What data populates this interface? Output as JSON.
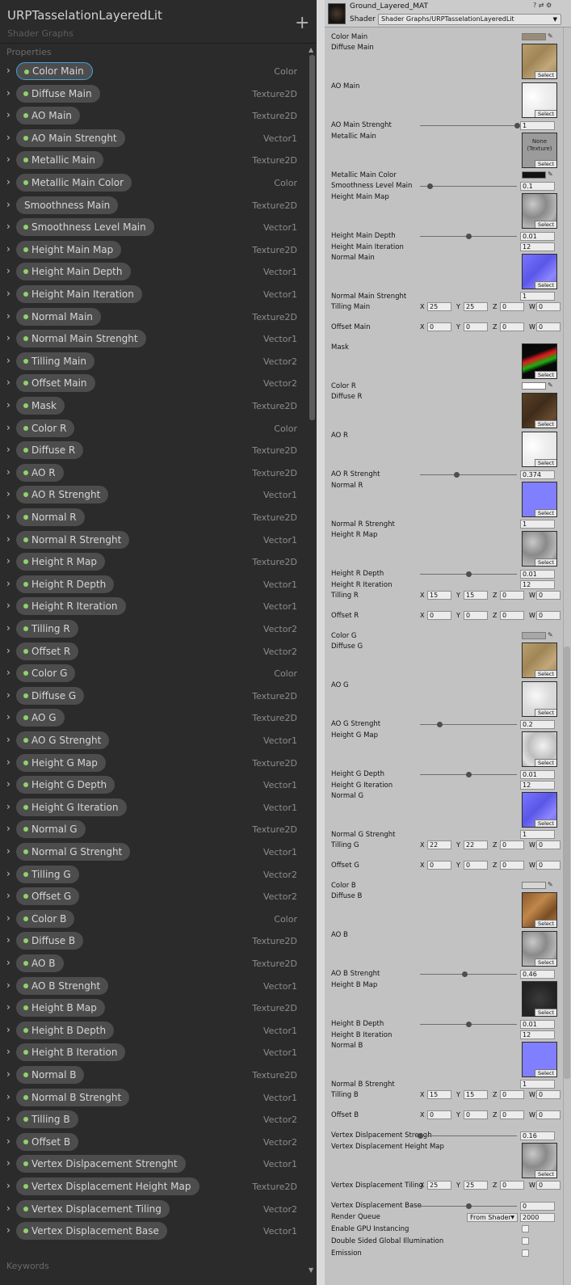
{
  "blackboard": {
    "title": "URPTasselationLayeredLit",
    "subtitle": "Shader Graphs",
    "add_icon": "+",
    "properties_label": "Properties",
    "keywords_label": "Keywords",
    "properties": [
      {
        "name": "Color Main",
        "type": "Color",
        "selected": true,
        "dot": true
      },
      {
        "name": "Diffuse Main",
        "type": "Texture2D",
        "dot": true
      },
      {
        "name": "AO Main",
        "type": "Texture2D",
        "dot": true
      },
      {
        "name": "AO Main Strenght",
        "type": "Vector1",
        "dot": true
      },
      {
        "name": "Metallic Main",
        "type": "Texture2D",
        "dot": true
      },
      {
        "name": "Metallic Main Color",
        "type": "Color",
        "dot": true
      },
      {
        "name": "Smoothness Main",
        "type": "Texture2D",
        "dot": false
      },
      {
        "name": "Smoothness Level Main",
        "type": "Vector1",
        "dot": true
      },
      {
        "name": "Height Main Map",
        "type": "Texture2D",
        "dot": true
      },
      {
        "name": "Height Main Depth",
        "type": "Vector1",
        "dot": true
      },
      {
        "name": "Height Main Iteration",
        "type": "Vector1",
        "dot": true
      },
      {
        "name": "Normal Main",
        "type": "Texture2D",
        "dot": true
      },
      {
        "name": "Normal Main Strenght",
        "type": "Vector1",
        "dot": true
      },
      {
        "name": "Tilling Main",
        "type": "Vector2",
        "dot": true
      },
      {
        "name": "Offset Main",
        "type": "Vector2",
        "dot": true
      },
      {
        "name": "Mask",
        "type": "Texture2D",
        "dot": true
      },
      {
        "name": "Color R",
        "type": "Color",
        "dot": true
      },
      {
        "name": "Diffuse R",
        "type": "Texture2D",
        "dot": true
      },
      {
        "name": "AO R",
        "type": "Texture2D",
        "dot": true
      },
      {
        "name": "AO R Strenght",
        "type": "Vector1",
        "dot": true
      },
      {
        "name": "Normal R",
        "type": "Texture2D",
        "dot": true
      },
      {
        "name": "Normal R Strenght",
        "type": "Vector1",
        "dot": true
      },
      {
        "name": "Height R Map",
        "type": "Texture2D",
        "dot": true
      },
      {
        "name": "Height R Depth",
        "type": "Vector1",
        "dot": true
      },
      {
        "name": "Height R Iteration",
        "type": "Vector1",
        "dot": true
      },
      {
        "name": "Tilling R",
        "type": "Vector2",
        "dot": true
      },
      {
        "name": "Offset R",
        "type": "Vector2",
        "dot": true
      },
      {
        "name": "Color G",
        "type": "Color",
        "dot": true
      },
      {
        "name": "Diffuse G",
        "type": "Texture2D",
        "dot": true
      },
      {
        "name": "AO G",
        "type": "Texture2D",
        "dot": true
      },
      {
        "name": "AO G Strenght",
        "type": "Vector1",
        "dot": true
      },
      {
        "name": "Height G Map",
        "type": "Texture2D",
        "dot": true
      },
      {
        "name": "Height G Depth",
        "type": "Vector1",
        "dot": true
      },
      {
        "name": "Height G Iteration",
        "type": "Vector1",
        "dot": true
      },
      {
        "name": "Normal G",
        "type": "Texture2D",
        "dot": true
      },
      {
        "name": "Normal G Strenght",
        "type": "Vector1",
        "dot": true
      },
      {
        "name": "Tilling G",
        "type": "Vector2",
        "dot": true
      },
      {
        "name": "Offset G",
        "type": "Vector2",
        "dot": true
      },
      {
        "name": "Color B",
        "type": "Color",
        "dot": true
      },
      {
        "name": "Diffuse B",
        "type": "Texture2D",
        "dot": true
      },
      {
        "name": "AO B",
        "type": "Texture2D",
        "dot": true
      },
      {
        "name": "AO B Strenght",
        "type": "Vector1",
        "dot": true
      },
      {
        "name": "Height B Map",
        "type": "Texture2D",
        "dot": true
      },
      {
        "name": "Height B Depth",
        "type": "Vector1",
        "dot": true
      },
      {
        "name": "Height B Iteration",
        "type": "Vector1",
        "dot": true
      },
      {
        "name": "Normal B",
        "type": "Texture2D",
        "dot": true
      },
      {
        "name": "Normal B Strenght",
        "type": "Vector1",
        "dot": true
      },
      {
        "name": "Tilling B",
        "type": "Vector2",
        "dot": true
      },
      {
        "name": "Offset B",
        "type": "Vector2",
        "dot": true
      },
      {
        "name": "Vertex Dislpacement Strenght",
        "type": "Vector1",
        "dot": true
      },
      {
        "name": "Vertex Displacement Height Map",
        "type": "Texture2D",
        "dot": true
      },
      {
        "name": "Vertex Displacement Tiling",
        "type": "Vector2",
        "dot": true
      },
      {
        "name": "Vertex Displacement Base",
        "type": "Vector1",
        "dot": true
      }
    ]
  },
  "inspector": {
    "material_name": "Ground_Layered_MAT",
    "shader_label": "Shader",
    "shader_value": "Shader Graphs/URPTasselationLayeredLit",
    "header_icons": "? ⇄ ⚙",
    "select_label": "Select",
    "none_texture_label": "None\n(Texture)",
    "entries": [
      {
        "kind": "color",
        "label": "Color Main",
        "color": "#998d7a"
      },
      {
        "kind": "texture",
        "label": "Diffuse Main",
        "tex": "sand"
      },
      {
        "kind": "texture",
        "label": "AO Main",
        "tex": "ao_white"
      },
      {
        "kind": "slider",
        "label": "AO Main Strenght",
        "value": "1",
        "fraction": 1.0
      },
      {
        "kind": "texture",
        "label": "Metallic Main",
        "tex": "none"
      },
      {
        "kind": "color",
        "label": "Metallic Main Color",
        "color": "#111111"
      },
      {
        "kind": "slider",
        "label": "Smoothness Level Main",
        "value": "0.1",
        "fraction": 0.1
      },
      {
        "kind": "texture",
        "label": "Height Main Map",
        "tex": "noise_gray"
      },
      {
        "kind": "slider",
        "label": "Height Main Depth",
        "value": "0.01",
        "fraction": 0.5
      },
      {
        "kind": "field",
        "label": "Height Main Iteration",
        "value": "12"
      },
      {
        "kind": "texture",
        "label": "Normal Main",
        "tex": "normal"
      },
      {
        "kind": "field",
        "label": "Normal Main Strenght",
        "value": "1"
      },
      {
        "kind": "vec4",
        "label": "Tilling Main",
        "x": "25",
        "y": "25",
        "z": "0",
        "w": "0"
      },
      {
        "kind": "vec4",
        "label": "Offset Main",
        "x": "0",
        "y": "0",
        "z": "0",
        "w": "0"
      },
      {
        "kind": "texture",
        "label": "Mask",
        "tex": "mask"
      },
      {
        "kind": "color",
        "label": "Color R",
        "color": "#ffffff"
      },
      {
        "kind": "texture",
        "label": "Diffuse R",
        "tex": "dirt_dark"
      },
      {
        "kind": "texture",
        "label": "AO R",
        "tex": "ao_white"
      },
      {
        "kind": "slider",
        "label": "AO R Strenght",
        "value": "0.374",
        "fraction": 0.374
      },
      {
        "kind": "texture",
        "label": "Normal R",
        "tex": "normal_flat"
      },
      {
        "kind": "field",
        "label": "Normal R Strenght",
        "value": "1"
      },
      {
        "kind": "texture",
        "label": "Height R Map",
        "tex": "noise_gray"
      },
      {
        "kind": "slider",
        "label": "Height R Depth",
        "value": "0.01",
        "fraction": 0.5
      },
      {
        "kind": "field",
        "label": "Height R Iteration",
        "value": "12"
      },
      {
        "kind": "vec4",
        "label": "Tilling R",
        "x": "15",
        "y": "15",
        "z": "0",
        "w": "0"
      },
      {
        "kind": "vec4",
        "label": "Offset R",
        "x": "0",
        "y": "0",
        "z": "0",
        "w": "0"
      },
      {
        "kind": "color",
        "label": "Color G",
        "color": "#a7a7a7"
      },
      {
        "kind": "texture",
        "label": "Diffuse G",
        "tex": "sand"
      },
      {
        "kind": "texture",
        "label": "AO G",
        "tex": "ao_light"
      },
      {
        "kind": "slider",
        "label": "AO G Strenght",
        "value": "0.2",
        "fraction": 0.2
      },
      {
        "kind": "texture",
        "label": "Height G Map",
        "tex": "noise_light"
      },
      {
        "kind": "slider",
        "label": "Height G Depth",
        "value": "0.01",
        "fraction": 0.5
      },
      {
        "kind": "field",
        "label": "Height G Iteration",
        "value": "12"
      },
      {
        "kind": "texture",
        "label": "Normal G",
        "tex": "normal"
      },
      {
        "kind": "field",
        "label": "Normal G Strenght",
        "value": "1"
      },
      {
        "kind": "vec4",
        "label": "Tilling G",
        "x": "22",
        "y": "22",
        "z": "0",
        "w": "0"
      },
      {
        "kind": "vec4",
        "label": "Offset G",
        "x": "0",
        "y": "0",
        "z": "0",
        "w": "0"
      },
      {
        "kind": "color",
        "label": "Color B",
        "color": "#d6d6d6"
      },
      {
        "kind": "texture",
        "label": "Diffuse B",
        "tex": "dirt_orange"
      },
      {
        "kind": "texture",
        "label": "AO B",
        "tex": "noise_gray"
      },
      {
        "kind": "slider",
        "label": "AO B Strenght",
        "value": "0.46",
        "fraction": 0.46
      },
      {
        "kind": "texture",
        "label": "Height B Map",
        "tex": "dark"
      },
      {
        "kind": "slider",
        "label": "Height B Depth",
        "value": "0.01",
        "fraction": 0.5
      },
      {
        "kind": "field",
        "label": "Height B Iteration",
        "value": "12"
      },
      {
        "kind": "texture",
        "label": "Normal B",
        "tex": "normal_flat"
      },
      {
        "kind": "field",
        "label": "Normal B Strenght",
        "value": "1"
      },
      {
        "kind": "vec4",
        "label": "Tilling B",
        "x": "15",
        "y": "15",
        "z": "0",
        "w": "0"
      },
      {
        "kind": "vec4",
        "label": "Offset B",
        "x": "0",
        "y": "0",
        "z": "0",
        "w": "0"
      },
      {
        "kind": "slider",
        "label": "Vertex Dislpacement Strengh",
        "value": "0.16",
        "fraction": 0.0
      },
      {
        "kind": "texture",
        "label": "Vertex Displacement Height Map",
        "tex": "noise_gray"
      },
      {
        "kind": "vec4",
        "label": "Vertex Displacement Tiling",
        "x": "25",
        "y": "25",
        "z": "0",
        "w": "0"
      },
      {
        "kind": "slider",
        "label": "Vertex Displacement Base",
        "value": "0",
        "fraction": 0.5
      },
      {
        "kind": "dropdown",
        "label": "Render Queue",
        "option": "From Shader",
        "value": "2000"
      },
      {
        "kind": "checkbox",
        "label": "Enable GPU Instancing",
        "checked": false
      },
      {
        "kind": "checkbox",
        "label": "Double Sided Global Illumination",
        "checked": false
      },
      {
        "kind": "checkbox",
        "label": "Emission",
        "checked": false
      }
    ]
  },
  "colors": {
    "blackboard_bg": "#2b2b2b",
    "pill_bg": "#4d4d4d",
    "dot_green": "#8fd36a",
    "selection_blue": "#41a2e0",
    "inspector_bg": "#c2c2c2"
  }
}
